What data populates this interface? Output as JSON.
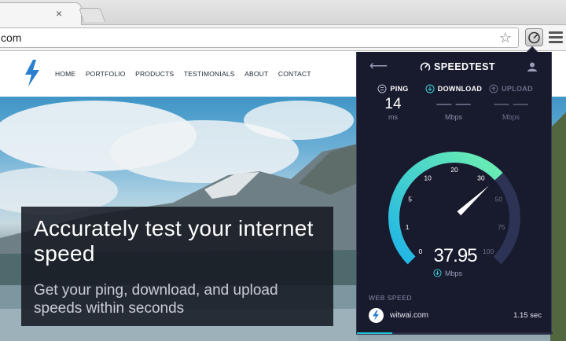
{
  "browser": {
    "tab_close": "×",
    "url": "com",
    "star_icon": "☆"
  },
  "site": {
    "nav": [
      "HOME",
      "PORTFOLIO",
      "PRODUCTS",
      "TESTIMONIALS",
      "ABOUT",
      "CONTACT"
    ],
    "hero_title": "Accurately test your internet speed",
    "hero_subtitle": "Get your ping, download, and upload speeds within seconds",
    "logo_color": "#2a7fd0"
  },
  "speedtest": {
    "brand": "SPEEDTEST",
    "ping": {
      "label": "PING",
      "value": "14",
      "unit": "ms"
    },
    "download": {
      "label": "DOWNLOAD",
      "value": "— —",
      "unit": "Mbps"
    },
    "upload": {
      "label": "UPLOAD",
      "value": "— —",
      "unit": "Mbps"
    },
    "gauge": {
      "ticks": [
        "0",
        "1",
        "5",
        "10",
        "20",
        "30",
        "50",
        "75",
        "100"
      ],
      "current": "37.95",
      "unit": "Mbps",
      "fill_value": 37.95
    },
    "web_speed_label": "WEB SPEED",
    "site": {
      "name": "witwai.com",
      "time": "1.15 sec"
    },
    "colors": {
      "accent_cyan": "#1fc3df",
      "accent_green": "#6ef0b0",
      "track": "#2c3354"
    }
  }
}
